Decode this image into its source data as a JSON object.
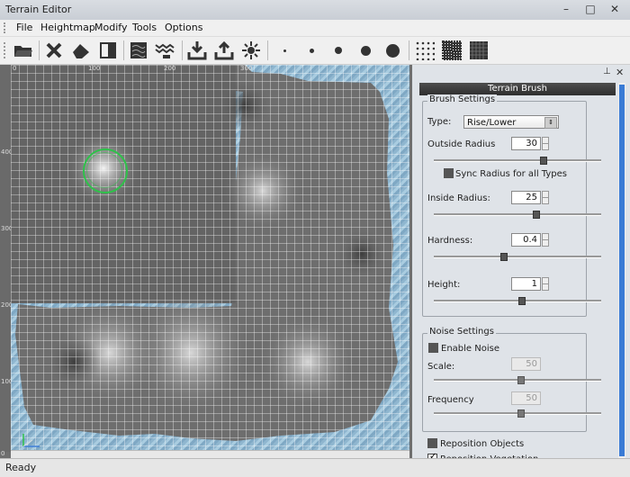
{
  "window": {
    "title": "Terrain Editor",
    "min": "–",
    "max": "□",
    "close": "✕"
  },
  "menu": [
    "File",
    "Heightmap",
    "Modify",
    "Tools",
    "Options"
  ],
  "toolbar": {
    "tools": [
      "open-folder-icon",
      "delete-icon",
      "eraser-icon",
      "half-square-icon",
      "terrain-texture-icon",
      "heightmap-icon",
      "import-icon",
      "export-icon",
      "sun-icon"
    ],
    "brush_sizes": [
      "tiny",
      "small",
      "medium",
      "large",
      "xlarge"
    ],
    "patterns": [
      "sparse",
      "medium",
      "dense"
    ]
  },
  "viewport": {
    "x_ruler": [
      "0",
      "100",
      "200",
      "300"
    ],
    "y_ruler": [
      "400",
      "300",
      "200",
      "100",
      "0"
    ]
  },
  "panel": {
    "title": "Terrain Brush",
    "brush_settings": {
      "legend": "Brush Settings",
      "type_label": "Type:",
      "type_value": "Rise/Lower",
      "outside_radius_label": "Outside Radius",
      "outside_radius_value": "30",
      "sync_label": "Sync Radius for all Types",
      "inside_radius_label": "Inside Radius:",
      "inside_radius_value": "25",
      "hardness_label": "Hardness:",
      "hardness_value": "0.4",
      "height_label": "Height:",
      "height_value": "1"
    },
    "noise_settings": {
      "legend": "Noise Settings",
      "enable_label": "Enable Noise",
      "scale_label": "Scale:",
      "scale_value": "50",
      "frequency_label": "Frequency",
      "frequency_value": "50"
    },
    "reposition_objects": "Reposition Objects",
    "reposition_vegetation": "Reposition Vegetation"
  },
  "status": "Ready"
}
